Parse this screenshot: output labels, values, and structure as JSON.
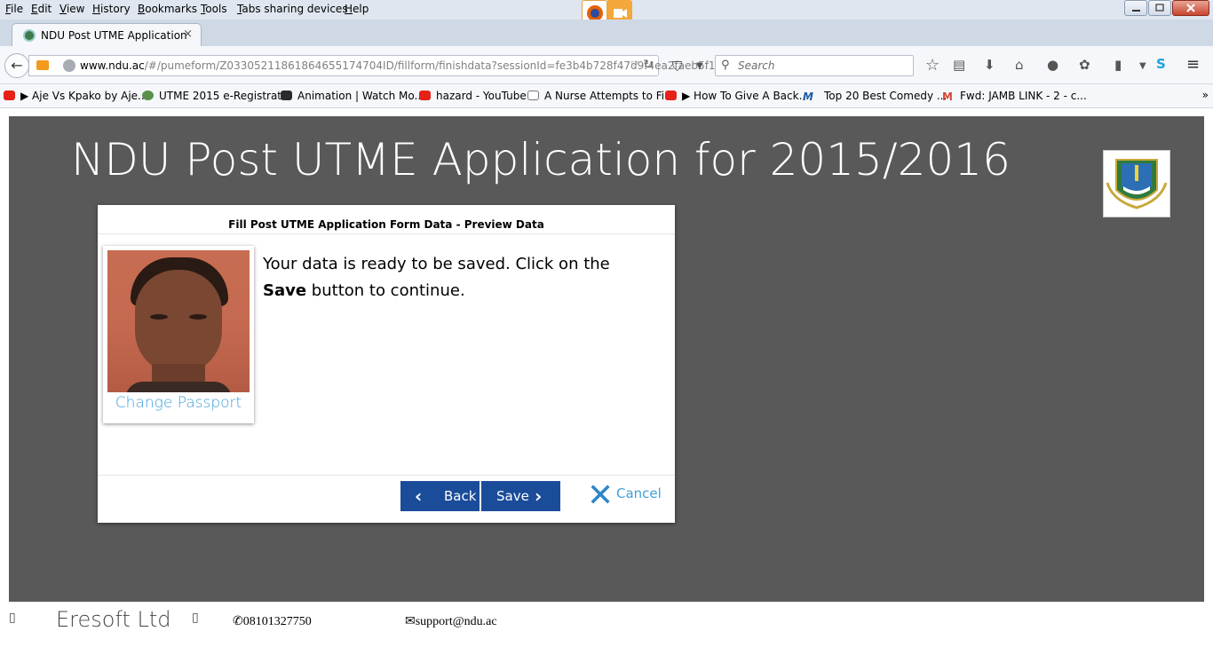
{
  "menubar": {
    "items": [
      "File",
      "Edit",
      "View",
      "History",
      "Bookmarks",
      "Tools",
      "Tabs sharing devices",
      "Help"
    ]
  },
  "tab": {
    "title": "NDU Post UTME Application",
    "close": "×",
    "new_tab": "+"
  },
  "navbar": {
    "url_host": "www.ndu.ac",
    "url_path": "/#/pumeform/Z0330521186186465517470 4ID/fillform/finishdata?sessionId=fe3b4b728f47d9f4ea2faeb5f1",
    "search_placeholder": "Search"
  },
  "bookmarks": [
    {
      "label": "▶ Aje Vs Kpako by Aje...",
      "icon": "youtube-icon"
    },
    {
      "label": "UTME 2015 e-Registrat...",
      "icon": "globe-icon"
    },
    {
      "label": "Animation | Watch Mo...",
      "icon": "play-icon"
    },
    {
      "label": "hazard - YouTube",
      "icon": "youtube-icon"
    },
    {
      "label": "A Nurse Attempts to Fi...",
      "icon": "nurse-icon"
    },
    {
      "label": "▶ How To Give A Back...",
      "icon": "youtube-icon"
    },
    {
      "label": "Top 20 Best Comedy ...",
      "icon": "m-icon"
    },
    {
      "label": "Fwd: JAMB LINK - 2 - c...",
      "icon": "gmail-icon"
    }
  ],
  "page": {
    "title": "NDU Post UTME Application for 2015/2016",
    "card_title": "Fill Post UTME Application Form Data - Preview Data",
    "change_passport": "Change Passport",
    "message_pre": "Your data is ready to be saved. Click on the",
    "message_bold": "Save",
    "message_post": "button to continue.",
    "back_label": "Back",
    "save_label": "Save",
    "cancel_label": "Cancel"
  },
  "footer": {
    "company": "Eresoft Ltd",
    "phone": "08101327750",
    "email": "support@ndu.ac"
  }
}
